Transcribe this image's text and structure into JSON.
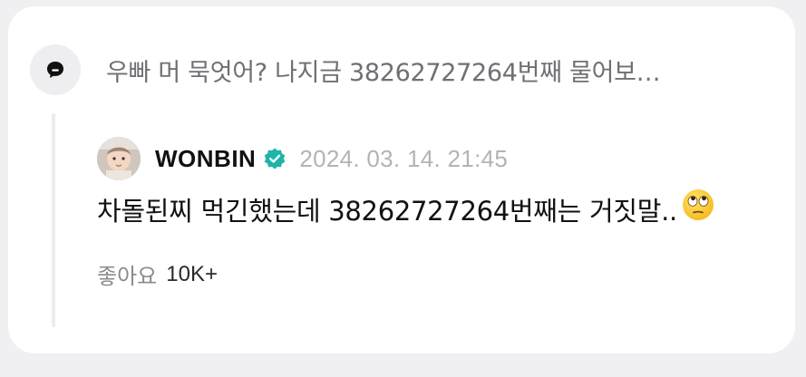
{
  "question": {
    "text": "우빠 머 묵엇어? 나지금 38262727264번째 물어보…",
    "avatar_icon": "anonymous-speech-bubble-icon"
  },
  "reply": {
    "author": "WONBIN",
    "verified_icon": "verified-badge-icon",
    "verified_color": "#1fb4a8",
    "timestamp": "2024. 03. 14. 21:45",
    "body": "차돌된찌 먹긴했는데 38262727264번째는 거짓말..",
    "emoji": "face-with-rolling-eyes-emoji",
    "likes_label": "좋아요",
    "likes_count": "10K+"
  }
}
